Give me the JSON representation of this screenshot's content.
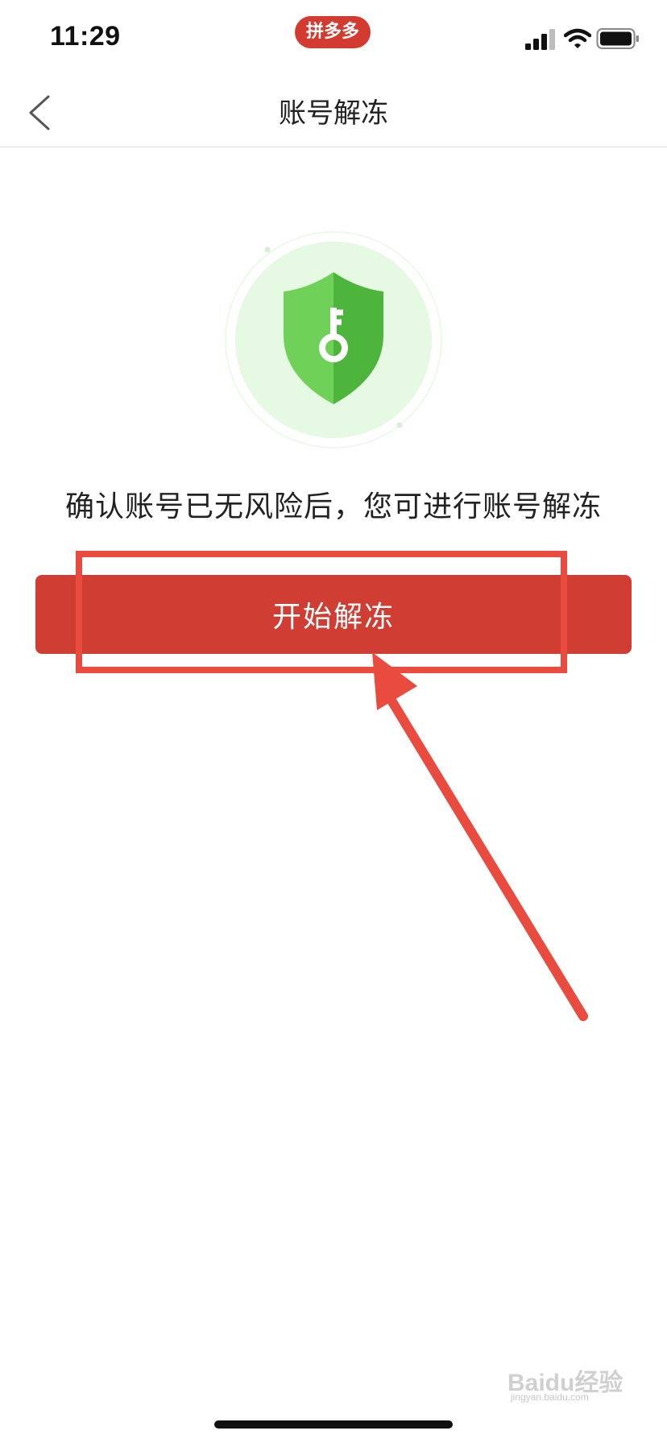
{
  "status_bar": {
    "time": "11:29",
    "app_badge": "拼多多",
    "icons": [
      "signal-icon",
      "wifi-icon",
      "battery-icon"
    ]
  },
  "nav": {
    "back_icon": "chevron-left-icon",
    "title": "账号解冻"
  },
  "illustration": {
    "icon": "shield-key-icon",
    "colors": {
      "halo": "#e6f9e2",
      "shield_light": "#6fd158",
      "shield_dark": "#4db43c"
    }
  },
  "info_text": "确认账号已无风险后，您可进行账号解冻",
  "primary_button": {
    "label": "开始解冻",
    "color": "#cf3d33"
  },
  "annotation": {
    "color": "#e94b3f",
    "shapes": [
      "highlight-box",
      "arrow"
    ]
  },
  "watermark": {
    "brand": "Baidu经验",
    "sub": "jingyan.baidu.com"
  }
}
